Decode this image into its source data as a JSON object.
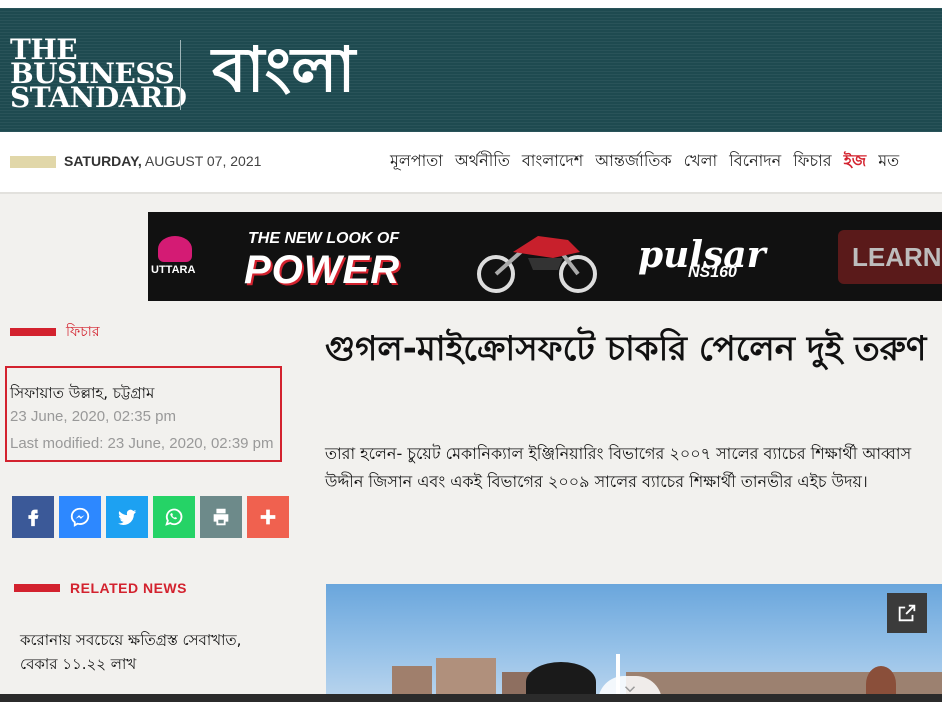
{
  "header": {
    "logo_line1": "THE",
    "logo_line2": "BUSINESS",
    "logo_line3": "STANDARD",
    "edition": "বাংলা",
    "bg_color": "#1e4a50"
  },
  "navbar": {
    "day": "SATURDAY,",
    "date": " AUGUST 07, 2021",
    "items": [
      "মূলপাতা",
      "অর্থনীতি",
      "বাংলাদেশ",
      "আন্তর্জাতিক",
      "খেলা",
      "বিনোদন",
      "ফিচার",
      "ইজ",
      "মত"
    ]
  },
  "ad": {
    "brand": "UTTARA",
    "tagline": "THE NEW LOOK OF",
    "power": "POWER",
    "model": "pulsar",
    "model_sub": "NS160",
    "cta": "LEARN"
  },
  "sidebar": {
    "section": "ফিচার",
    "author": "সিফায়াত উল্লাহ, চট্টগ্রাম",
    "published": "23 June, 2020, 02:35 pm",
    "modified": "Last modified: 23 June, 2020, 02:39 pm",
    "share": [
      {
        "name": "facebook",
        "color": "#3b5998"
      },
      {
        "name": "messenger",
        "color": "#2d88ff"
      },
      {
        "name": "twitter",
        "color": "#1da1f2"
      },
      {
        "name": "whatsapp",
        "color": "#25d366"
      },
      {
        "name": "print",
        "color": "#6d8a8a"
      },
      {
        "name": "more",
        "color": "#f0614f"
      }
    ],
    "related_label": "RELATED NEWS",
    "related_items": [
      "করোনায় সবচেয়ে ক্ষতিগ্রস্ত সেবাখাত, বেকার ১১.২২ লাখ"
    ]
  },
  "article": {
    "headline": "গুগল-মাইক্রোসফটে চাকরি পেলেন দুই তরুণ",
    "summary": "তারা হলেন- চুয়েট মেকানিক্যাল ইঞ্জিনিয়ারিং বিভাগের ২০০৭ সালের ব্যাচের শিক্ষার্থী আব্বাস উদ্দীন জিসান এবং একই বিভাগের ২০০৯ সালের ব্যাচের শিক্ষার্থী তানভীর এইচ উদয়।"
  },
  "colors": {
    "accent": "#d3222e"
  }
}
